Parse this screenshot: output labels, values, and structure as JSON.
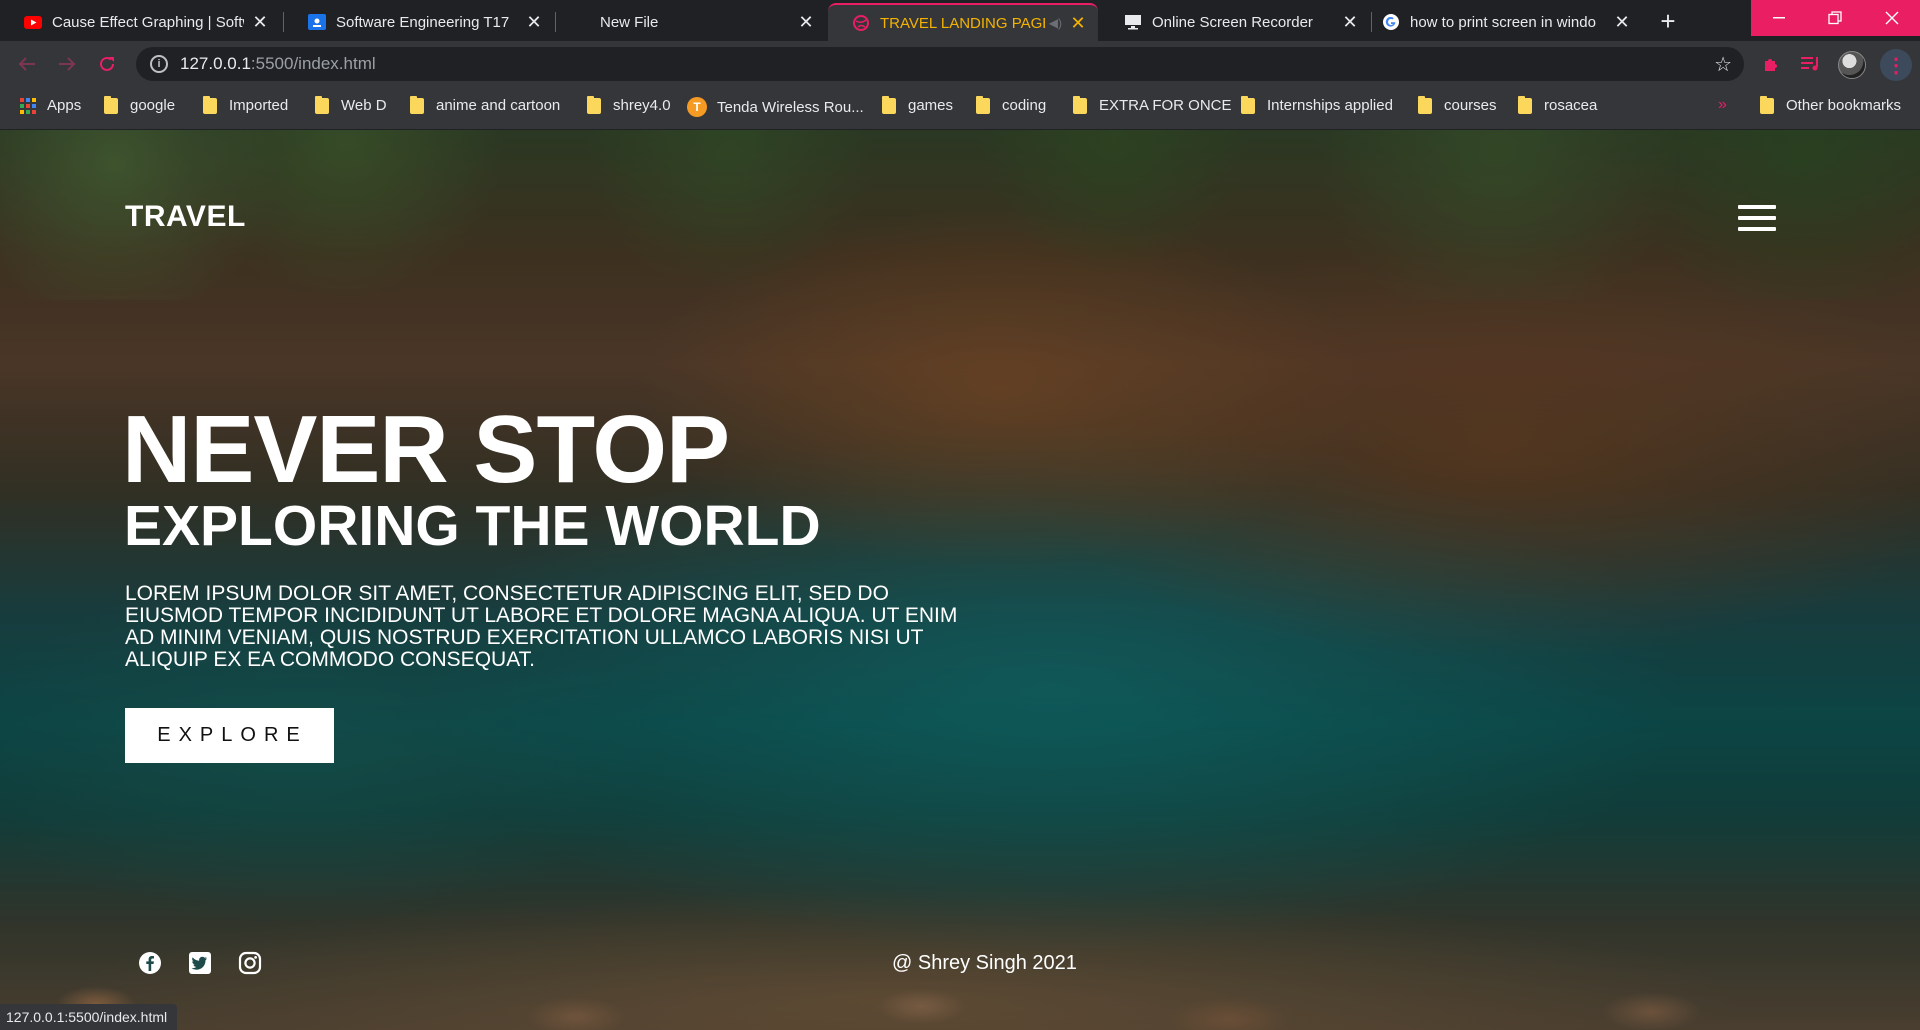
{
  "tabs": [
    {
      "title": "Cause Effect Graphing | Softw",
      "icon": "youtube-icon",
      "color": "#ff0000"
    },
    {
      "title": "Software Engineering T17",
      "icon": "classroom-icon",
      "color": "#1a73e8"
    },
    {
      "title": "New File",
      "icon": "",
      "color": ""
    },
    {
      "title": "TRAVEL LANDING PAGE",
      "icon": "globe-icon",
      "color": "#e91e63"
    },
    {
      "title": "Online Screen Recorder",
      "icon": "monitor-icon",
      "color": "#e8eaed"
    },
    {
      "title": "how to print screen in windo",
      "icon": "google-icon",
      "color": "#4285f4"
    }
  ],
  "address_bar": {
    "host": "127.0.0.1",
    "path": ":5500/index.html"
  },
  "bookmarks": {
    "apps": "Apps",
    "items": [
      "google",
      "Imported",
      "Web D",
      "anime and cartoon",
      "shrey4.0",
      "Tenda Wireless Rou...",
      "games",
      "coding",
      "EXTRA FOR ONCE",
      "Internships applied",
      "courses",
      "rosacea"
    ],
    "more": "»",
    "other": "Other bookmarks"
  },
  "page": {
    "brand": "TRAVEL",
    "headline_1": "NEVER STOP",
    "headline_2": "EXPLORING THE WORLD",
    "body": "LOREM IPSUM DOLOR SIT AMET, CONSECTETUR ADIPISCING ELIT, SED DO EIUSMOD TEMPOR INCIDIDUNT UT LABORE ET DOLORE MAGNA ALIQUA. UT ENIM AD MINIM VENIAM, QUIS NOSTRUD EXERCITATION ULLAMCO LABORIS NISI UT ALIQUIP EX EA COMMODO CONSEQUAT.",
    "cta": "EXPLORE",
    "social": [
      "facebook-icon",
      "twitter-icon",
      "instagram-icon"
    ],
    "credit": "@ Shrey Singh 2021"
  },
  "status_bar": "127.0.0.1:5500/index.html",
  "colors": {
    "accent": "#e91e63",
    "active_tab_text": "#f5b301",
    "folder": "#fbd75b"
  }
}
